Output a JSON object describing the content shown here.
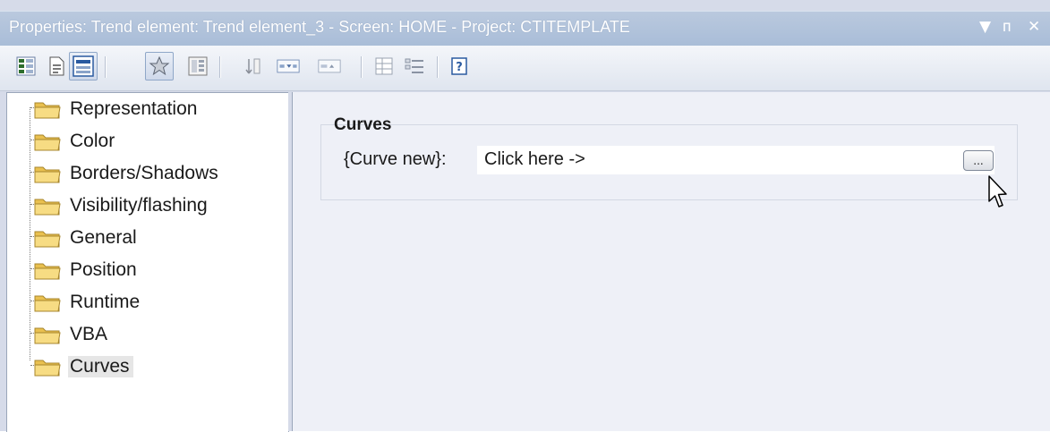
{
  "window": {
    "title": "Properties: Trend element: Trend element_3 - Screen: HOME - Project: CTITEMPLATE",
    "controls": {
      "dropdown": "▼",
      "pin": "ᴨ",
      "close": "✕"
    }
  },
  "toolbar": {
    "buttons": [
      {
        "name": "grid-view-icon"
      },
      {
        "name": "page-view-icon"
      },
      {
        "name": "property-list-icon",
        "pressed": true
      },
      {
        "name": "favorites-icon",
        "pressed": true
      },
      {
        "name": "properties-icon"
      },
      {
        "name": "sort-icon"
      },
      {
        "name": "collapse-icon"
      },
      {
        "name": "expand-icon"
      },
      {
        "name": "grid-small-icon"
      },
      {
        "name": "list-icon"
      },
      {
        "name": "help-icon"
      }
    ]
  },
  "tree": {
    "items": [
      {
        "label": "Representation"
      },
      {
        "label": "Color"
      },
      {
        "label": "Borders/Shadows"
      },
      {
        "label": "Visibility/flashing"
      },
      {
        "label": "General"
      },
      {
        "label": "Position"
      },
      {
        "label": "Runtime"
      },
      {
        "label": "VBA"
      },
      {
        "label": "Curves",
        "selected": true
      }
    ]
  },
  "content": {
    "group_title": "Curves",
    "property": {
      "label": "{Curve new}:",
      "value": "Click here ->",
      "button_label": "..."
    }
  },
  "colors": {
    "titlebar": "#a9bdd8",
    "folder": "#f3d46e",
    "selection": "#e6e6e6"
  }
}
